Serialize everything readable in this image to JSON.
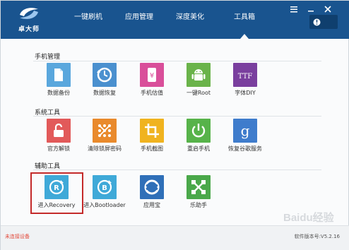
{
  "app": {
    "logo_text": "卓大师"
  },
  "nav": {
    "items": [
      "一键刷机",
      "应用管理",
      "深度美化",
      "工具箱"
    ],
    "active_index": 3
  },
  "sections": [
    {
      "title": "手机管理",
      "tools": [
        {
          "label": "数据备份",
          "icon": "data-backup-icon",
          "color": "#5aa7dd"
        },
        {
          "label": "数据恢复",
          "icon": "data-restore-icon",
          "color": "#4a90cf"
        },
        {
          "label": "手机估值",
          "icon": "phone-value-icon",
          "color": "#d94f9a"
        },
        {
          "label": "一键Root",
          "icon": "android-root-icon",
          "color": "#6ab34a"
        },
        {
          "label": "字体DIY",
          "icon": "font-ttf-icon",
          "color": "#7a3f9e"
        }
      ]
    },
    {
      "title": "系统工具",
      "tools": [
        {
          "label": "官方解锁",
          "icon": "unlock-icon",
          "color": "#e25a5a"
        },
        {
          "label": "清除锁屏密码",
          "icon": "clear-lock-icon",
          "color": "#e98a2c"
        },
        {
          "label": "手机截图",
          "icon": "crop-screenshot-icon",
          "color": "#f0b31f"
        },
        {
          "label": "重启手机",
          "icon": "power-restart-icon",
          "color": "#57b34a"
        },
        {
          "label": "恢复谷歌服务",
          "icon": "google-icon",
          "color": "#3f7ccc"
        }
      ]
    },
    {
      "title": "辅助工具",
      "tools": [
        {
          "label": "进入Recovery",
          "icon": "recovery-icon",
          "color": "#3fa9d8"
        },
        {
          "label": "进入Bootloader",
          "icon": "bootloader-icon",
          "color": "#3fa9d8"
        },
        {
          "label": "应用宝",
          "icon": "app-store-icon",
          "color": "#2f6fb8"
        },
        {
          "label": "乐助手",
          "icon": "helper-icon",
          "color": "#4aa84a"
        }
      ]
    }
  ],
  "footer": {
    "status": "未连接设备",
    "version": "软件版本号:V5.2.16"
  },
  "watermark": "Baidu经验"
}
